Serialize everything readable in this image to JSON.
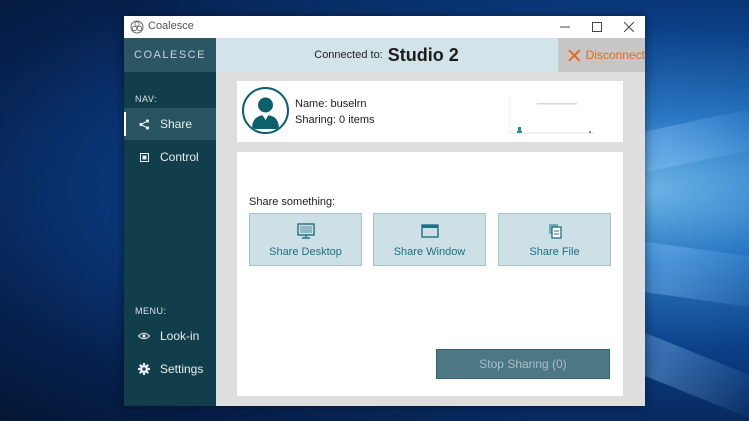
{
  "window": {
    "title": "Coalesce"
  },
  "sidebar": {
    "logo": "COALESCE",
    "nav_label": "NAV:",
    "nav_items": [
      {
        "label": "Share",
        "icon": "share-icon",
        "active": true
      },
      {
        "label": "Control",
        "icon": "control-icon",
        "active": false
      }
    ],
    "menu_label": "MENU:",
    "menu_items": [
      {
        "label": "Look-in",
        "icon": "eye-icon"
      },
      {
        "label": "Settings",
        "icon": "gear-icon"
      }
    ]
  },
  "header": {
    "connected_label": "Connected to:",
    "studio": "Studio 2",
    "disconnect_label": "Disconnect"
  },
  "profile": {
    "name": "Name: buselrn",
    "sharing": "Sharing: 0 items"
  },
  "share": {
    "prompt": "Share something:",
    "buttons": [
      {
        "label": "Share Desktop",
        "icon": "monitor-icon"
      },
      {
        "label": "Share Window",
        "icon": "window-icon"
      },
      {
        "label": "Share File",
        "icon": "file-icon"
      }
    ],
    "stop_label": "Stop Sharing (0)"
  },
  "colors": {
    "sidebar": "#123e4b",
    "accent": "#1f6f86",
    "disconnect": "#e06a1e"
  }
}
